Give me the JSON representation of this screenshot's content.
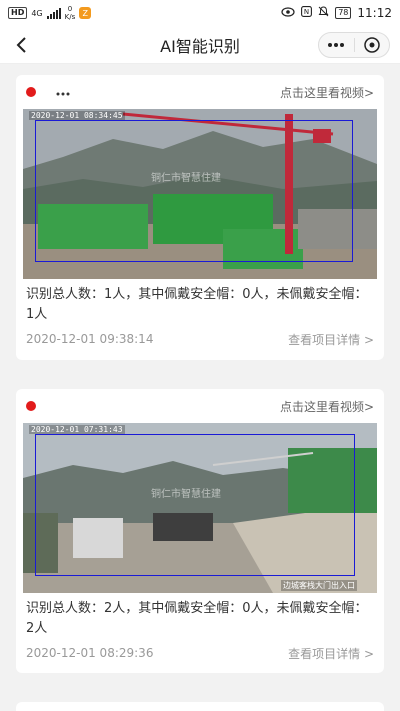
{
  "statusbar": {
    "hd": "HD",
    "net": "4G",
    "speed_value": "0",
    "speed_unit": "K/s",
    "app_badge": "Z",
    "battery": "78",
    "time": "11:12"
  },
  "nav": {
    "title": "AI智能识别",
    "back_icon": "chevron-left-icon",
    "more_icon": "more-dots-icon",
    "close_icon": "close-circle-icon"
  },
  "records": [
    {
      "camera_name": "",
      "video_link": "点击这里看视频>",
      "osd_time": "2020-12-01 08:34:45",
      "watermark": "铜仁市智慧住建",
      "cam_label": "",
      "stat_text": "识别总人数：1人，其中佩戴安全帽：0人，未佩戴安全帽：1人",
      "time": "2020-12-01 09:38:14",
      "detail_link": "查看项目详情 >"
    },
    {
      "camera_name": "",
      "video_link": "点击这里看视频>",
      "osd_time": "2020-12-01 07:31:43",
      "watermark": "铜仁市智慧住建",
      "cam_label": "边城客栈大门出入口",
      "stat_text": "识别总人数：2人，其中佩戴安全帽：0人，未佩戴安全帽：2人",
      "time": "2020-12-01 08:29:36",
      "detail_link": "查看项目详情 >"
    }
  ],
  "colors": {
    "alert_dot": "#e21b1b",
    "detection_box": "#1a1ad6",
    "background": "#f2f2f2"
  }
}
